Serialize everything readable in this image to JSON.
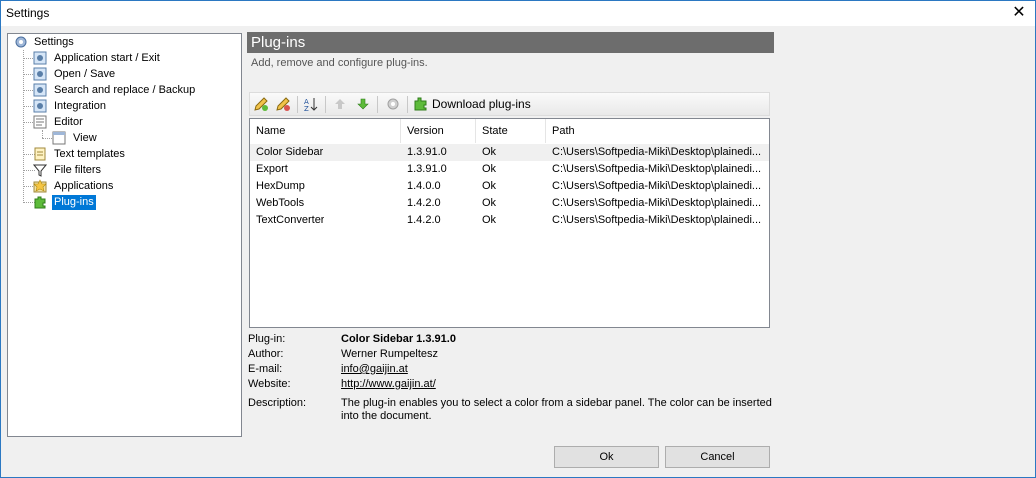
{
  "window": {
    "title": "Settings",
    "close_glyph": "✕"
  },
  "tree": {
    "root": "Settings",
    "items": [
      {
        "label": "Application start / Exit",
        "icon": "app-start-icon"
      },
      {
        "label": "Open / Save",
        "icon": "open-save-icon"
      },
      {
        "label": "Search and replace / Backup",
        "icon": "search-replace-icon"
      },
      {
        "label": "Integration",
        "icon": "integration-icon"
      },
      {
        "label": "Editor",
        "icon": "editor-icon"
      },
      {
        "label": "View",
        "icon": "view-icon"
      },
      {
        "label": "Text templates",
        "icon": "text-templates-icon"
      },
      {
        "label": "File filters",
        "icon": "filter-icon"
      },
      {
        "label": "Applications",
        "icon": "applications-icon"
      },
      {
        "label": "Plug-ins",
        "icon": "puzzle-icon"
      }
    ],
    "selected": "Plug-ins"
  },
  "panel": {
    "title": "Plug-ins",
    "subtitle": "Add, remove and configure plug-ins."
  },
  "toolbar": {
    "download_label": "Download plug-ins"
  },
  "list": {
    "columns": [
      "Name",
      "Version",
      "State",
      "Path"
    ],
    "rows": [
      {
        "name": "Color Sidebar",
        "version": "1.3.91.0",
        "state": "Ok",
        "path": "C:\\Users\\Softpedia-Miki\\Desktop\\plainedi..."
      },
      {
        "name": "Export",
        "version": "1.3.91.0",
        "state": "Ok",
        "path": "C:\\Users\\Softpedia-Miki\\Desktop\\plainedi..."
      },
      {
        "name": "HexDump",
        "version": "1.4.0.0",
        "state": "Ok",
        "path": "C:\\Users\\Softpedia-Miki\\Desktop\\plainedi..."
      },
      {
        "name": "WebTools",
        "version": "1.4.2.0",
        "state": "Ok",
        "path": "C:\\Users\\Softpedia-Miki\\Desktop\\plainedi..."
      },
      {
        "name": "TextConverter",
        "version": "1.4.2.0",
        "state": "Ok",
        "path": "C:\\Users\\Softpedia-Miki\\Desktop\\plainedi..."
      }
    ]
  },
  "info": {
    "plugin_label": "Plug-in:",
    "plugin_value": "Color Sidebar 1.3.91.0",
    "author_label": "Author:",
    "author_value": "Werner Rumpeltesz",
    "email_label": "E-mail:",
    "email_value": "info@gaijin.at",
    "website_label": "Website:",
    "website_value": "http://www.gaijin.at/",
    "description_label": "Description:",
    "description_line1": "The plug-in enables you to select a color from a sidebar panel. The color can be inserted",
    "description_line2": "into the document."
  },
  "buttons": {
    "ok": "Ok",
    "cancel": "Cancel"
  }
}
